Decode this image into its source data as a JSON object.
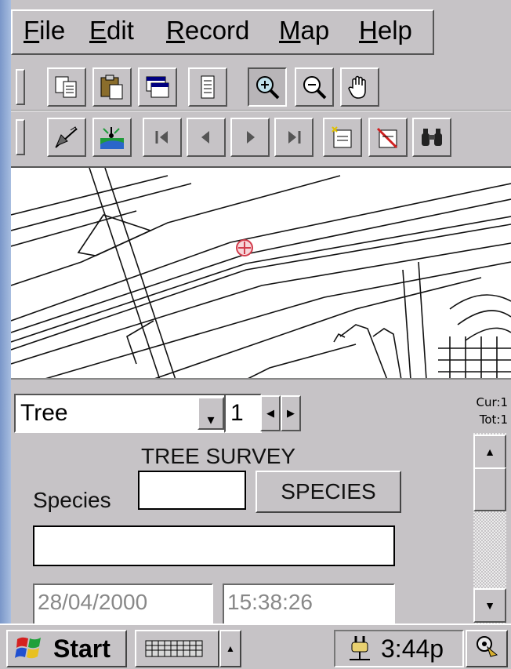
{
  "menu": {
    "items": [
      "File",
      "Edit",
      "Record",
      "Map",
      "Help"
    ]
  },
  "toolbar1": {
    "buttons": [
      "copy-icon",
      "paste-icon",
      "window-icon",
      "document-icon",
      "zoom-in-icon",
      "zoom-out-icon",
      "pan-hand-icon"
    ],
    "active": "zoom-in-icon"
  },
  "toolbar2": {
    "buttons": [
      "pencil-capture-icon",
      "gps-satellite-icon",
      "first-record-icon",
      "previous-record-icon",
      "next-record-icon",
      "last-record-icon",
      "add-record-icon",
      "delete-record-icon",
      "find-binoculars-icon"
    ]
  },
  "record_bar": {
    "layer": "Tree",
    "record_number": "1",
    "cur_label": "Cur:1",
    "tot_label": "Tot:1"
  },
  "form": {
    "title": "TREE SURVEY",
    "species_label": "Species",
    "species_code_value": "",
    "species_button": "SPECIES",
    "species_name_value": "",
    "date_value": "28/04/2000",
    "time_value": "15:38:26"
  },
  "taskbar": {
    "start_label": "Start",
    "clock": "3:44p"
  },
  "colors": {
    "window_bg": "#c6c3c6",
    "desktop": "#8fa9d3",
    "map_bg": "#ffffff",
    "gps_marker": "#d23c4c"
  }
}
